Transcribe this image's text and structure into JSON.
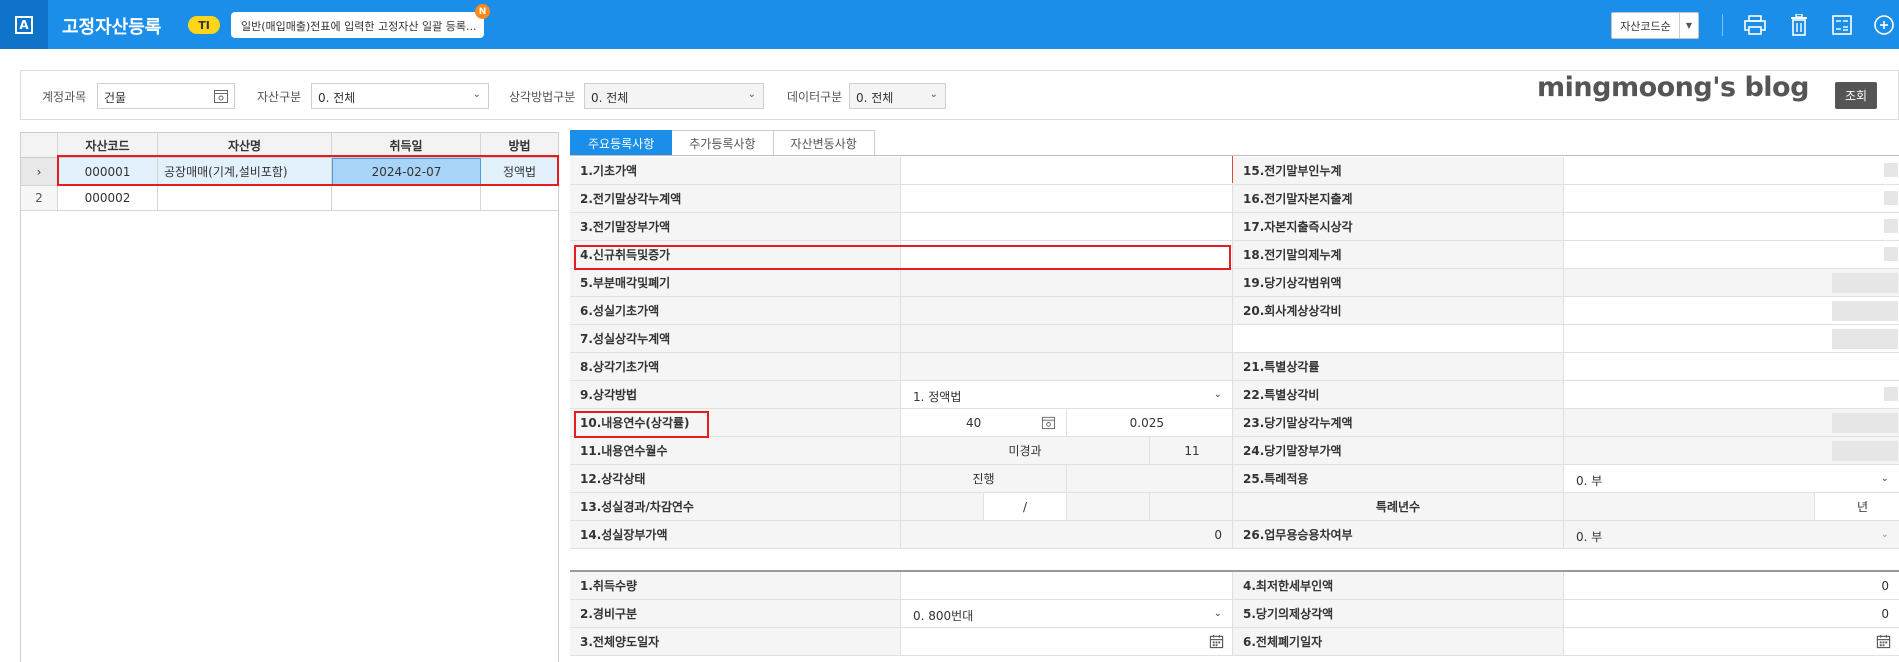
{
  "app": {
    "title": "고정자산등록",
    "badge": "TI",
    "notice": "일반(매입매출)전표에 입력한 고정자산 일괄 등록...",
    "notice_dot": "N",
    "sort_label": "자산코드순"
  },
  "filters": {
    "account_label": "계정과목",
    "account_value": "건물",
    "asset_type_label": "자산구분",
    "asset_type_value": "0. 전체",
    "depreciation_label": "상각방법구분",
    "depreciation_value": "0. 전체",
    "data_label": "데이터구분",
    "data_value": "0. 전체",
    "search_button": "조회",
    "watermark": "mingmoong's blog"
  },
  "grid": {
    "columns": [
      "자산코드",
      "자산명",
      "취득일",
      "방법"
    ],
    "rows": [
      {
        "no": "",
        "code": "000001",
        "name": "공장매매(기계,설비포함)",
        "date": "2024-02-07",
        "method": "정액법"
      },
      {
        "no": "2",
        "code": "000002",
        "name": "",
        "date": "",
        "method": ""
      }
    ]
  },
  "tabs": [
    "주요등록사항",
    "추가등록사항",
    "자산변동사항"
  ],
  "fields_left": [
    "1.기초가액",
    "2.전기말상각누계액",
    "3.전기말장부가액",
    "4.신규취득및증가",
    "5.부분매각및폐기",
    "6.성실기초가액",
    "7.성실상각누계액",
    "8.상각기초가액",
    "9.상각방법",
    "10.내용연수(상각률)",
    "11.내용연수월수",
    "12.상각상태",
    "13.성실경과/차감연수",
    "14.성실장부가액"
  ],
  "fields_right": [
    "15.전기말부인누계",
    "16.전기말자본지출계",
    "17.자본지출즉시상각",
    "18.전기말의제누계",
    "19.당기상각범위액",
    "20.회사계상상각비",
    "",
    "21.특별상각률",
    "22.특별상각비",
    "23.당기말상각누계액",
    "24.당기말장부가액",
    "25.특례적용",
    "특례년수",
    "26.업무용승용차여부"
  ],
  "values": {
    "method": "1. 정액법",
    "life_years": "40",
    "rate": "0.025",
    "months_status": "미경과",
    "months_value": "11",
    "status": "진행",
    "slash": "/",
    "sincere_book": "0",
    "special_apply": "0. 부",
    "special_years_unit": "년",
    "business_car": "0. 부"
  },
  "fields_bottom_left": [
    "1.취득수량",
    "2.경비구분",
    "3.전체양도일자"
  ],
  "fields_bottom_right": [
    "4.최저한세부인액",
    "5.당기의제상각액",
    "6.전체폐기일자"
  ],
  "bottom_values": {
    "expense_type": "0. 800번대",
    "min_tax": "0",
    "deemed_dep": "0"
  },
  "colors": {
    "topbar": "#1a8ee9",
    "topbar_dark": "#0f73c9",
    "highlight": "#e41e1e",
    "selected_row": "#e3f1fd"
  }
}
